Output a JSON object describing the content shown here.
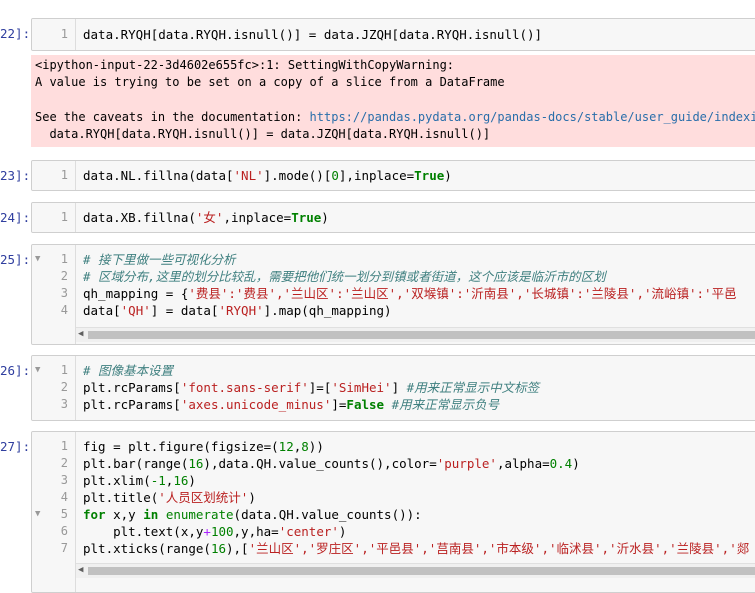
{
  "cells": [
    {
      "prompt": "22]:",
      "lines": [
        "1"
      ],
      "output": {
        "line1": "<ipython-input-22-3d4602e655fc>:1: SettingWithCopyWarning:",
        "line2": "A value is trying to be set on a copy of a slice from a DataFrame",
        "line3_prefix": "See the caveats in the documentation: ",
        "line3_link": "https://pandas.pydata.org/pandas-docs/stable/user_guide/indexing.",
        "line4": "  data.RYQH[data.RYQH.isnull()] = data.JZQH[data.RYQH.isnull()]"
      }
    },
    {
      "prompt": "23]:",
      "lines": [
        "1"
      ]
    },
    {
      "prompt": "24]:",
      "lines": [
        "1"
      ]
    },
    {
      "prompt": "25]:",
      "lines": [
        "1",
        "2",
        "3",
        "4"
      ]
    },
    {
      "prompt": "26]:",
      "lines": [
        "1",
        "2",
        "3"
      ]
    },
    {
      "prompt": "27]:",
      "lines": [
        "1",
        "2",
        "3",
        "4",
        "5",
        "6",
        "7"
      ]
    }
  ],
  "code": {
    "c22_l1": "data.RYQH[data.RYQH.isnull()] = data.JZQH[data.RYQH.isnull()]",
    "c23_l1_a": "data.NL.fillna(data[",
    "c23_l1_b": "'NL'",
    "c23_l1_c": "].mode()[",
    "c23_l1_d": "0",
    "c23_l1_e": "],inplace=",
    "c23_l1_f": "True",
    "c23_l1_g": ")",
    "c24_l1_a": "data.XB.fillna(",
    "c24_l1_b": "'女'",
    "c24_l1_c": ",inplace=",
    "c24_l1_d": "True",
    "c24_l1_e": ")",
    "c25_l1": "# 接下里做一些可视化分析",
    "c25_l2": "# 区域分布,这里的划分比较乱，需要把他们统一划分到镇或者街道，这个应该是临沂市的区划",
    "c25_l3_a": "qh_mapping = {",
    "c25_l3_b": "'费县':'费县','兰山区':'兰山区','双堠镇':'沂南县','长城镇':'兰陵县','流峪镇':'平邑",
    "c25_l4_a": "data[",
    "c25_l4_b": "'QH'",
    "c25_l4_c": "] = data[",
    "c25_l4_d": "'RYQH'",
    "c25_l4_e": "].map(qh_mapping)",
    "c26_l1": "# 图像基本设置",
    "c26_l2_a": "plt.rcParams[",
    "c26_l2_b": "'font.sans-serif'",
    "c26_l2_c": "]=[",
    "c26_l2_d": "'SimHei'",
    "c26_l2_e": "] ",
    "c26_l2_f": "#用来正常显示中文标签",
    "c26_l3_a": "plt.rcParams[",
    "c26_l3_b": "'axes.unicode_minus'",
    "c26_l3_c": "]=",
    "c26_l3_d": "False",
    "c26_l3_e": " ",
    "c26_l3_f": "#用来正常显示负号",
    "c27_l1_a": "fig = plt.figure(figsize=(",
    "c27_l1_b": "12",
    "c27_l1_c": ",",
    "c27_l1_d": "8",
    "c27_l1_e": "))",
    "c27_l2_a": "plt.bar(range(",
    "c27_l2_b": "16",
    "c27_l2_c": "),data.QH.value_counts(),color=",
    "c27_l2_d": "'purple'",
    "c27_l2_e": ",alpha=",
    "c27_l2_f": "0.4",
    "c27_l2_g": ")",
    "c27_l3_a": "plt.xlim(",
    "c27_l3_b": "-1",
    "c27_l3_c": ",",
    "c27_l3_d": "16",
    "c27_l3_e": ")",
    "c27_l4_a": "plt.title(",
    "c27_l4_b": "'人员区划统计'",
    "c27_l4_c": ")",
    "c27_l5_a": "for",
    "c27_l5_b": " x,y ",
    "c27_l5_c": "in",
    "c27_l5_d": " ",
    "c27_l5_e": "enumerate",
    "c27_l5_f": "(data.QH.value_counts()):",
    "c27_l6_a": "    plt.text(x,y",
    "c27_l6_b": "+",
    "c27_l6_c": "100",
    "c27_l6_d": ",y,ha=",
    "c27_l6_e": "'center'",
    "c27_l6_f": ")",
    "c27_l7_a": "plt.xticks(range(",
    "c27_l7_b": "16",
    "c27_l7_c": "),[",
    "c27_l7_d": "'兰山区','罗庄区','平邑县','莒南县','市本级','临沭县','沂水县','兰陵县','郯"
  }
}
